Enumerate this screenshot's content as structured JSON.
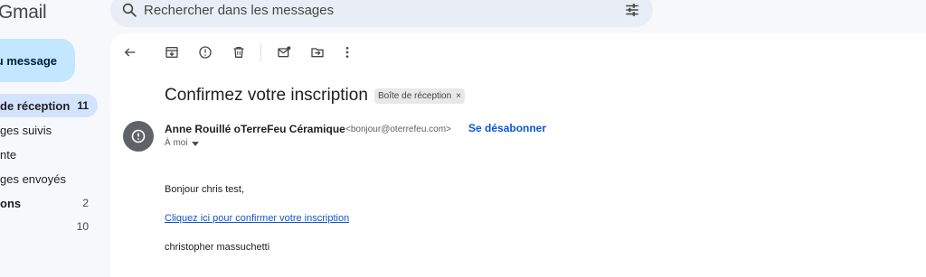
{
  "app": {
    "logo_text": "Gmail"
  },
  "search": {
    "placeholder": "Rechercher dans les messages"
  },
  "sidebar": {
    "compose_label": "au message",
    "items": [
      {
        "label": "de réception",
        "count": "11"
      },
      {
        "label": "ges suivis",
        "count": ""
      },
      {
        "label": "nte",
        "count": ""
      },
      {
        "label": "ges envoyés",
        "count": ""
      },
      {
        "label": "ons",
        "count": "2"
      },
      {
        "label": "",
        "count": "10"
      }
    ]
  },
  "email": {
    "subject": "Confirmez votre inscription",
    "label_chip": "Boîte de réception",
    "chip_close": "×",
    "sender_name": "Anne Rouillé oTerreFeu Céramique",
    "sender_email": "<bonjour@oterrefeu.com>",
    "unsubscribe": "Se désabonner",
    "recipient": "À moi",
    "greeting": "Bonjour chris test,",
    "confirm_link": "Cliquez ici pour confirmer votre inscription",
    "signature": "christopher massuchetti"
  },
  "colors": {
    "accent": "#0b57d0",
    "compose_bg": "#c2e7ff",
    "active_nav_bg": "#d3e3fd",
    "link": "#1155cc"
  }
}
